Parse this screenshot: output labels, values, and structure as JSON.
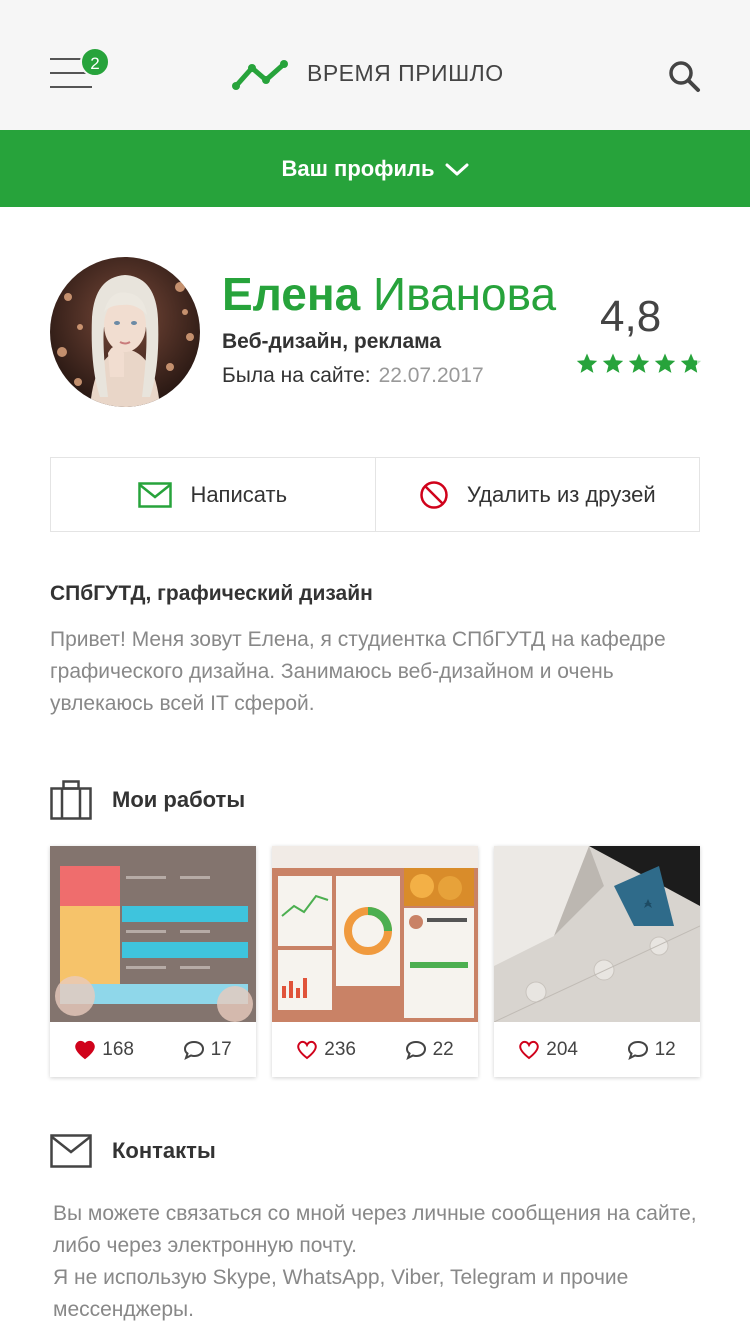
{
  "header": {
    "brand": "ВРЕМЯ ПРИШЛО",
    "notifications": "2",
    "profile_menu": "Ваш профиль"
  },
  "profile": {
    "first_name": "Елена",
    "last_name": "Иванова",
    "specialization": "Веб-дизайн, реклама",
    "last_seen_label": "Была на сайте:",
    "last_seen_date": "22.07.2017",
    "rating": "4,8",
    "rating_value": 4.8,
    "rating_max": 5
  },
  "actions": {
    "message": "Написать",
    "unfriend": "Удалить из друзей"
  },
  "about": {
    "education": "СПбГУТД, графический дизайн",
    "bio": "Привет! Меня зовут Елена, я студиентка СПбГУТД на кафедре графического дизайна. Занимаюсь веб-дизайном и очень увлекаюсь всей IT сферой."
  },
  "works": {
    "title": "Мои работы",
    "items": [
      {
        "likes": "168",
        "comments": "17",
        "liked": true
      },
      {
        "likes": "236",
        "comments": "22",
        "liked": false
      },
      {
        "likes": "204",
        "comments": "12",
        "liked": false
      }
    ]
  },
  "contacts": {
    "title": "Контакты",
    "line1": "Вы можете связаться со мной через личные сообщения на сайте, либо через электронную почту.",
    "line2": "Я не использую Skype, WhatsApp, Viber, Telegram и прочие мессенджеры."
  },
  "colors": {
    "accent": "#27a33b",
    "danger": "#d0021b"
  },
  "icons": [
    "menu-icon",
    "logo-chart-icon",
    "search-icon",
    "chevron-down-icon",
    "envelope-icon",
    "block-icon",
    "briefcase-icon",
    "heart-icon",
    "comment-icon",
    "star-icon"
  ]
}
